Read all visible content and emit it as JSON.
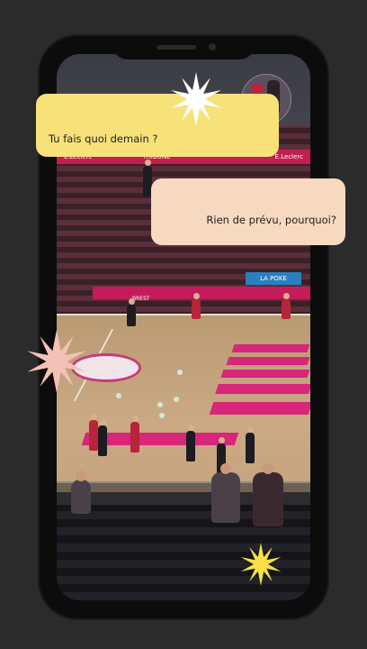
{
  "messages": [
    {
      "text": "Tu fais quoi demain ?",
      "side": "left",
      "color": "#f7e27a"
    },
    {
      "text": "Rien de prévu, pourquoi?",
      "side": "right",
      "color": "#f7d9c0"
    }
  ],
  "scene": {
    "banner_left": "E.Leclerc",
    "banner_middle": "TRIBUNE",
    "banner_right": "E.Leclerc",
    "board_text": "BREST",
    "board_logo": "LA POKE"
  },
  "icons": {
    "star_top": "starburst-white",
    "star_left": "starburst-pink",
    "star_bottom": "starburst-yellow"
  },
  "colors": {
    "background": "#2b2b2b",
    "bubble_yellow": "#f7e27a",
    "bubble_peach": "#f7d9c0",
    "court_pink": "#d8267b"
  }
}
